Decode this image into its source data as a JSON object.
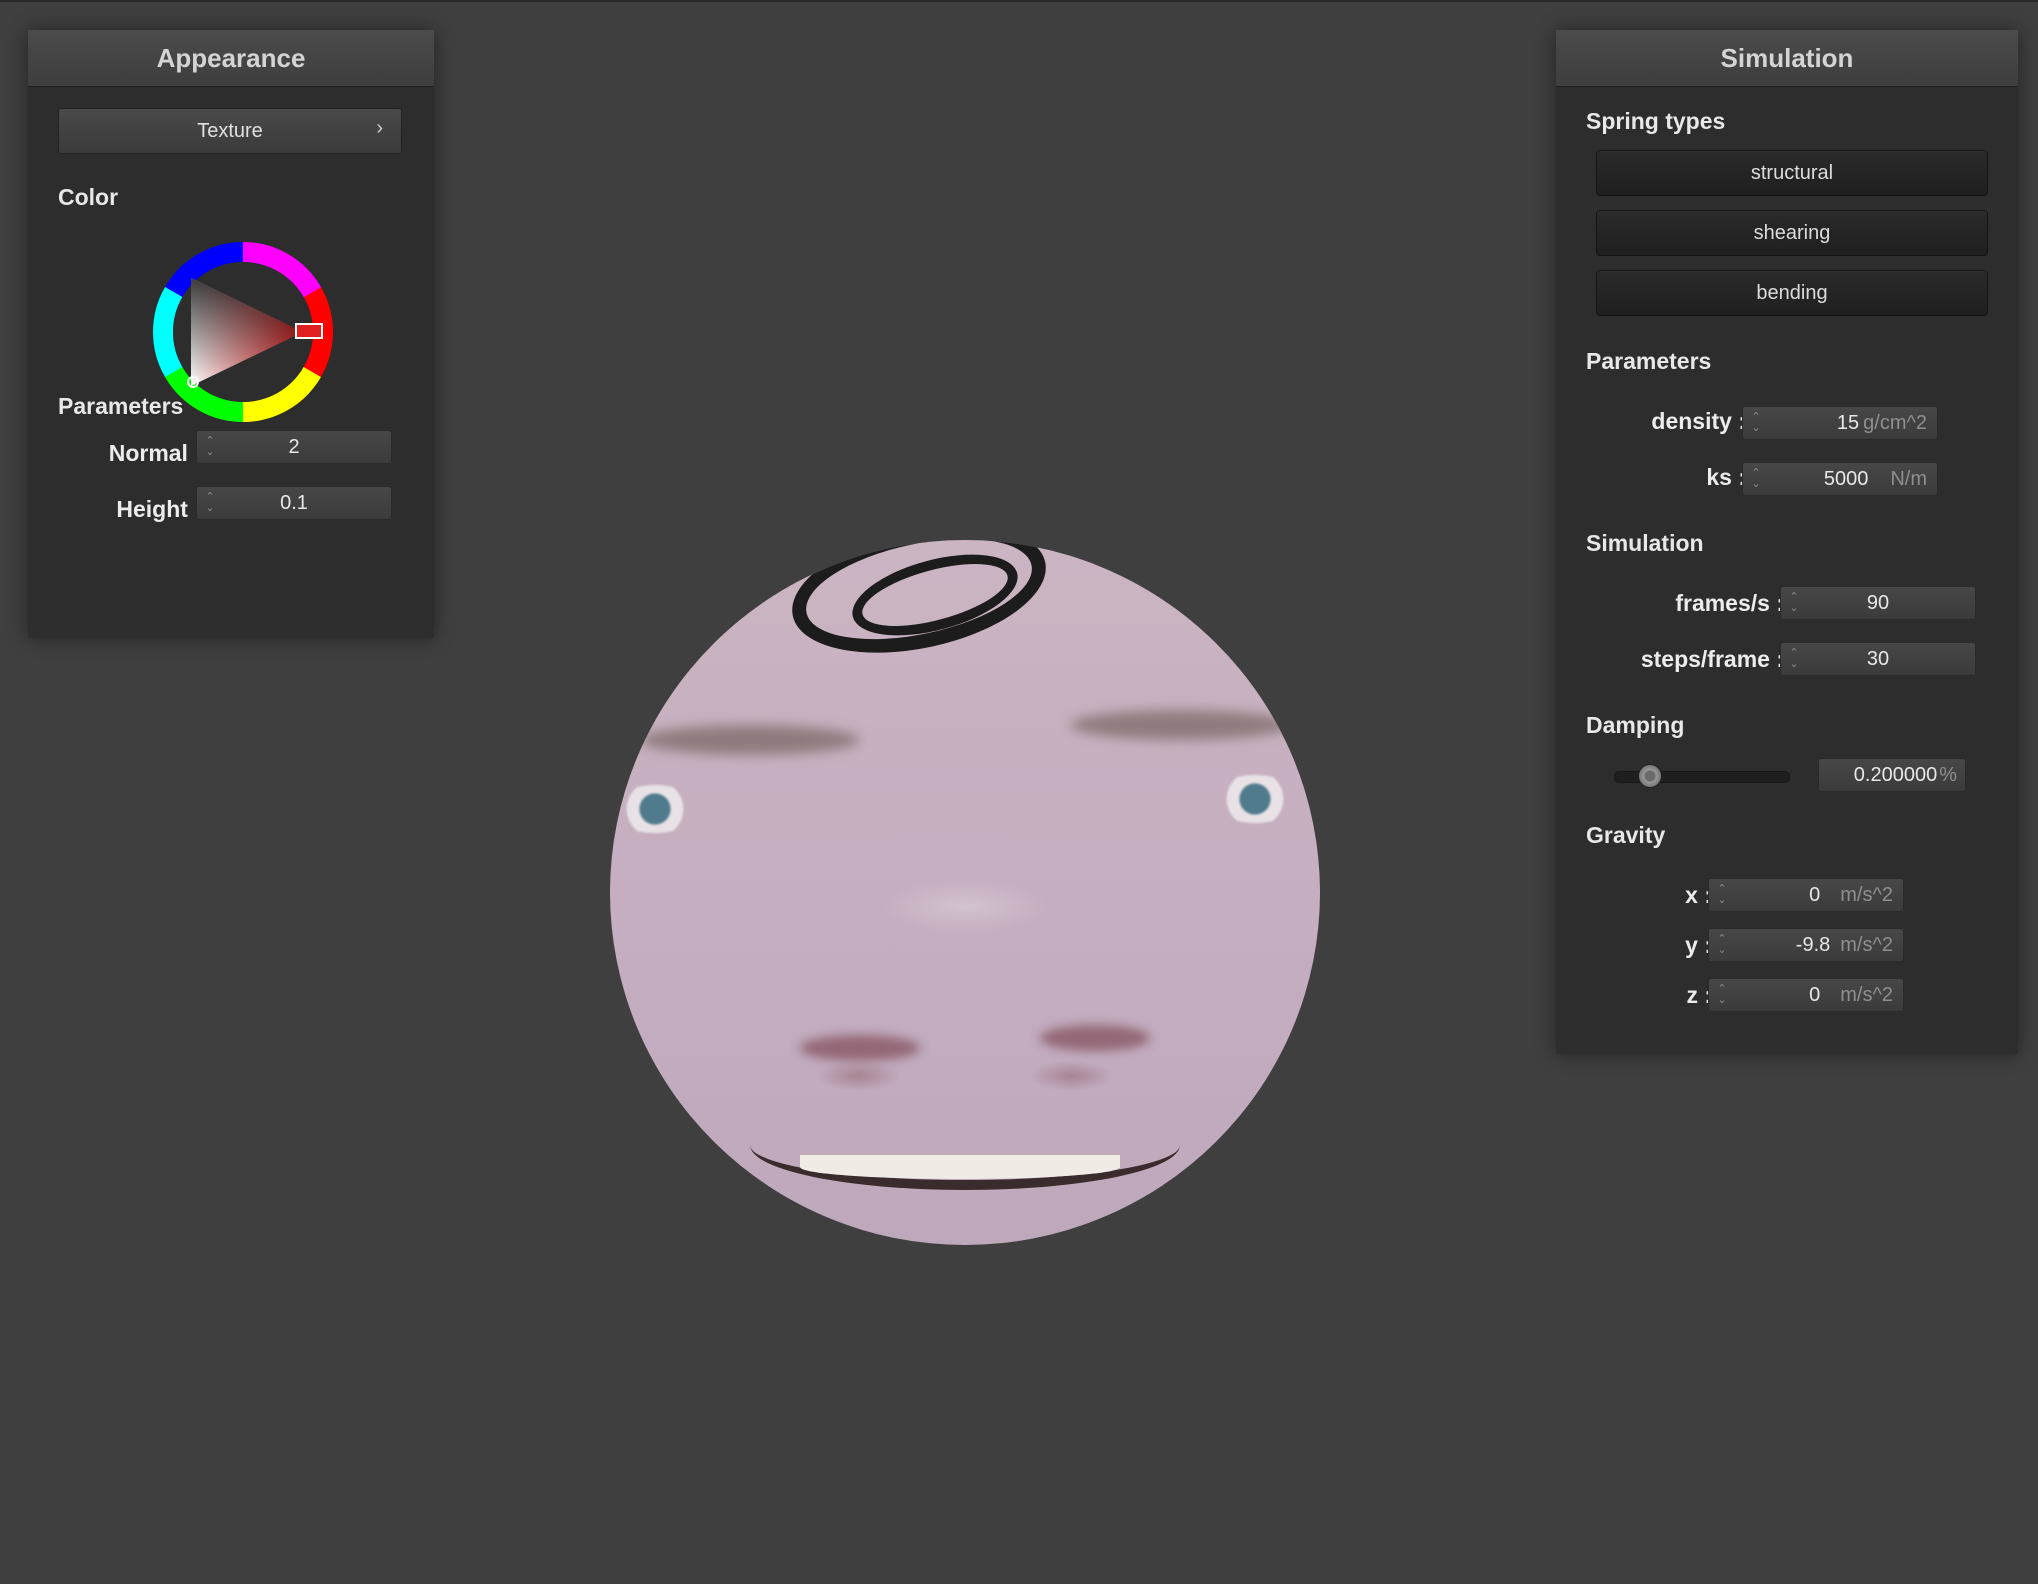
{
  "appearance": {
    "title": "Appearance",
    "texture_button": "Texture",
    "texture_chevron": "›",
    "color_label": "Color",
    "selected_color": "#e02020",
    "parameters_label": "Parameters",
    "normal_label": "Normal :",
    "normal_value": "2",
    "height_label": "Height :",
    "height_value": "0.1"
  },
  "simulation": {
    "title": "Simulation",
    "spring_types_label": "Spring types",
    "spring_buttons": [
      "structural",
      "shearing",
      "bending"
    ],
    "parameters_label": "Parameters",
    "density_label": "density :",
    "density_value": "15",
    "density_unit": "g/cm^2",
    "ks_label": "ks :",
    "ks_value": "5000",
    "ks_unit": "N/m",
    "simulation_label": "Simulation",
    "fps_label": "frames/s :",
    "fps_value": "90",
    "steps_label": "steps/frame :",
    "steps_value": "30",
    "damping_label": "Damping",
    "damping_fraction": 0.2,
    "damping_value": "0.200000",
    "damping_unit": "%",
    "gravity_label": "Gravity",
    "gx_label": "x :",
    "gx_value": "0",
    "gy_label": "y :",
    "gy_value": "-9.8",
    "gz_label": "z :",
    "gz_value": "0",
    "gravity_unit": "m/s^2"
  },
  "icons": {
    "up": "⌃",
    "down": "⌄"
  }
}
